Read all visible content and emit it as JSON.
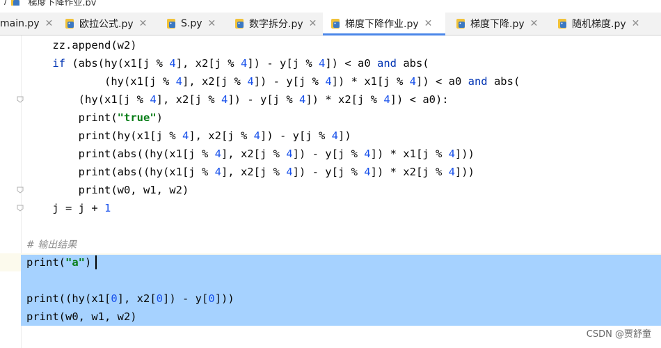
{
  "breadcrumb": {
    "file": "梯度下降作业.py"
  },
  "tabs": [
    {
      "label": "main.py",
      "active": false
    },
    {
      "label": "欧拉公式.py",
      "active": false
    },
    {
      "label": "S.py",
      "active": false
    },
    {
      "label": "数字拆分.py",
      "active": false
    },
    {
      "label": "梯度下降作业.py",
      "active": true
    },
    {
      "label": "梯度下降.py",
      "active": false
    },
    {
      "label": "随机梯度.py",
      "active": false
    }
  ],
  "code_lines": [
    "    zz.append(w2)",
    "    if (abs(hy(x1[j % 4], x2[j % 4]) - y[j % 4]) < a0 and abs(",
    "            (hy(x1[j % 4], x2[j % 4]) - y[j % 4]) * x1[j % 4]) < a0 and abs(",
    "        (hy(x1[j % 4], x2[j % 4]) - y[j % 4]) * x2[j % 4]) < a0):",
    "        print(\"true\")",
    "        print(hy(x1[j % 4], x2[j % 4]) - y[j % 4])",
    "        print(abs((hy(x1[j % 4], x2[j % 4]) - y[j % 4]) * x1[j % 4]))",
    "        print(abs((hy(x1[j % 4], x2[j % 4]) - y[j % 4]) * x2[j % 4]))",
    "        print(w0, w1, w2)",
    "    j = j + 1",
    "",
    "# 输出结果",
    "print(\"a\")",
    "",
    "print((hy(x1[0], x2[0]) - y[0]))",
    "print(w0, w1, w2)"
  ],
  "colors": {
    "keyword": "#0033b3",
    "number": "#1750eb",
    "string": "#067d17",
    "comment": "#8c8c8c",
    "selection": "#a6d2ff",
    "tab_underline": "#4a86e8"
  },
  "icons": {
    "tab_file": "python-file-icon",
    "tab_close": "close-icon",
    "fold": "fold-marker-icon"
  },
  "watermark": "CSDN @贾舒童"
}
